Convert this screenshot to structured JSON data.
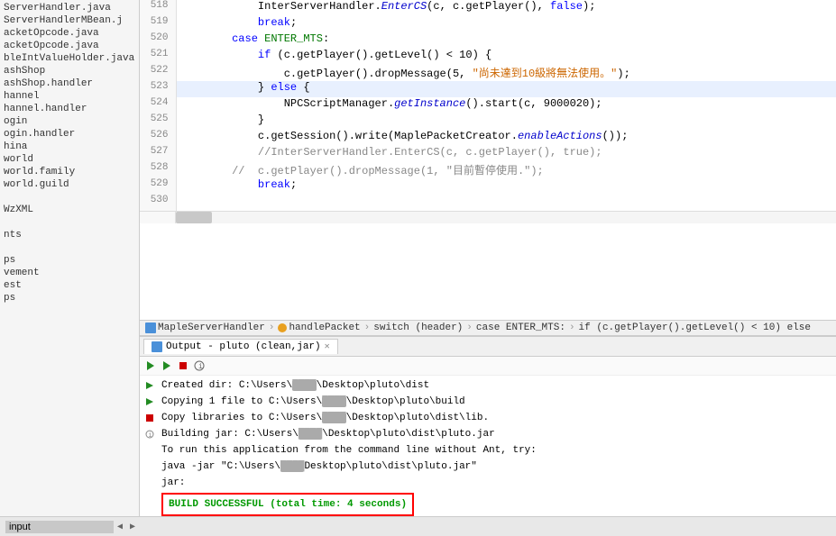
{
  "sidebar": {
    "items": [
      {
        "label": "ServerHandler.java"
      },
      {
        "label": "ServerHandlerMBean.j"
      },
      {
        "label": "acketOpcode.java"
      },
      {
        "label": "acketOpcode.java"
      },
      {
        "label": "bleIntValueHolder.java"
      },
      {
        "label": "ashShop"
      },
      {
        "label": "ashShop.handler"
      },
      {
        "label": "hannel"
      },
      {
        "label": "hannel.handler"
      },
      {
        "label": "ogin"
      },
      {
        "label": "ogin.handler"
      },
      {
        "label": "hina"
      },
      {
        "label": "world"
      },
      {
        "label": "world.family"
      },
      {
        "label": "world.guild"
      },
      {
        "label": ""
      },
      {
        "label": "WzXML"
      },
      {
        "label": ""
      },
      {
        "label": "nts"
      },
      {
        "label": ""
      },
      {
        "label": "ps"
      },
      {
        "label": "vement"
      },
      {
        "label": "est"
      },
      {
        "label": "ps"
      }
    ]
  },
  "code": {
    "lines": [
      {
        "num": 518,
        "text": "            InterServerHandler.EnterCS(c, c.getPlayer(), false);",
        "highlight": false
      },
      {
        "num": 519,
        "text": "            break;",
        "highlight": false
      },
      {
        "num": 520,
        "text": "        case ENTER_MTS:",
        "highlight": false
      },
      {
        "num": 521,
        "text": "            if (c.getPlayer().getLevel() < 10) {",
        "highlight": false
      },
      {
        "num": 522,
        "text": "                c.getPlayer().dropMessage(5, \"尚未達到10級將無法使用。\");",
        "highlight": false
      },
      {
        "num": 523,
        "text": "            } else {",
        "highlight": true
      },
      {
        "num": 524,
        "text": "                NPCScriptManager.getInstance().start(c, 9000020);",
        "highlight": false
      },
      {
        "num": 525,
        "text": "            }",
        "highlight": false
      },
      {
        "num": 526,
        "text": "            c.getSession().write(MaplePacketCreator.enableActions());",
        "highlight": false
      },
      {
        "num": 527,
        "text": "            //InterServerHandler.EnterCS(c, c.getPlayer(), true);",
        "highlight": false
      },
      {
        "num": 528,
        "text": "        //  c.getPlayer().dropMessage(1, \"目前暫停使用.\");",
        "highlight": false
      },
      {
        "num": 529,
        "text": "            break;",
        "highlight": false
      },
      {
        "num": 530,
        "text": "",
        "highlight": false
      }
    ]
  },
  "breadcrumb": {
    "items": [
      {
        "label": "MapleServerHandler"
      },
      {
        "label": "handlePacket"
      },
      {
        "label": "switch (header)"
      },
      {
        "label": "case ENTER_MTS:"
      },
      {
        "label": "if (c.getPlayer().getLevel() < 10) else"
      }
    ]
  },
  "output_panel": {
    "tab_label": "Output - pluto (clean,jar)",
    "lines": [
      {
        "icon": "run",
        "text": "Created dir: C:\\Users\\████\\Desktop\\pluto\\dist"
      },
      {
        "icon": "run",
        "text": "Copying 1 file to C:\\Users\\████\\Desktop\\pluto\\build"
      },
      {
        "icon": "stop",
        "text": "Copy libraries to C:\\Users\\████\\Desktop\\pluto\\dist\\lib."
      },
      {
        "icon": "info",
        "text": "Building jar: C:\\Users\\████\\Desktop\\pluto\\dist\\pluto.jar"
      },
      {
        "icon": "none",
        "text": "To run this application from the command line without Ant, try:"
      },
      {
        "icon": "none",
        "text": "java -jar \"C:\\Users\\████Desktop\\pluto\\dist\\pluto.jar\""
      },
      {
        "icon": "none",
        "text": "jar:"
      },
      {
        "icon": "success",
        "text": "BUILD SUCCESSFUL  (total time: 4 seconds)"
      }
    ]
  },
  "status_bar": {
    "input_label": "input"
  }
}
